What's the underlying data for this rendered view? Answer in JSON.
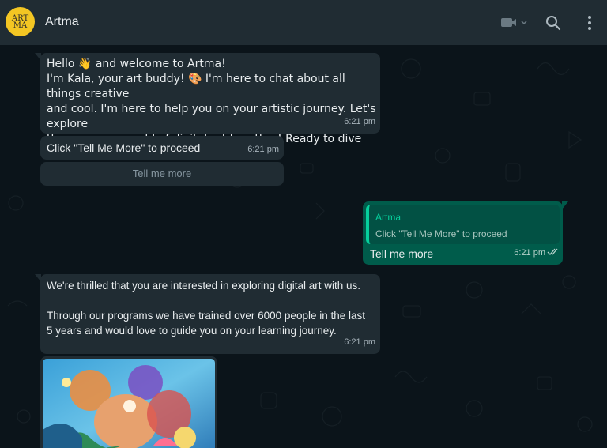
{
  "header": {
    "avatar_text_top": "ART",
    "avatar_text_bottom": "MA",
    "title": "Artma",
    "icons": [
      "video-call-icon",
      "search-icon",
      "menu-icon"
    ]
  },
  "messages": {
    "welcome": {
      "text": "Hello 👋 and welcome to Artma!\nI'm Kala, your art buddy! 🎨 I'm here to chat about all things creative\nand cool. I'm here to help you on your artistic journey. Let's explore\nthe awesome world of digital art together! Ready to dive in? 😊",
      "time": "6:21 pm"
    },
    "prompt": {
      "text": "Click \"Tell Me More\" to proceed",
      "time": "6:21 pm",
      "button_label": "Tell me more"
    },
    "reply": {
      "quote_name": "Artma",
      "quote_text": "Click \"Tell Me More\" to proceed",
      "text": "Tell me more",
      "time": "6:21 pm"
    },
    "info": {
      "text": "We're thrilled that you are interested in exploring digital art with us.\n\nThrough our programs we have trained over 6000 people in the last\n5 years and would love to guide you on your learning journey.",
      "time": "6:21 pm"
    }
  },
  "colors": {
    "header_bg": "#202c33",
    "chat_bg": "#0b141a",
    "incoming_bubble": "#202c33",
    "outgoing_bubble": "#005c4b",
    "accent": "#06cf9c",
    "avatar_bg": "#f3c623"
  }
}
